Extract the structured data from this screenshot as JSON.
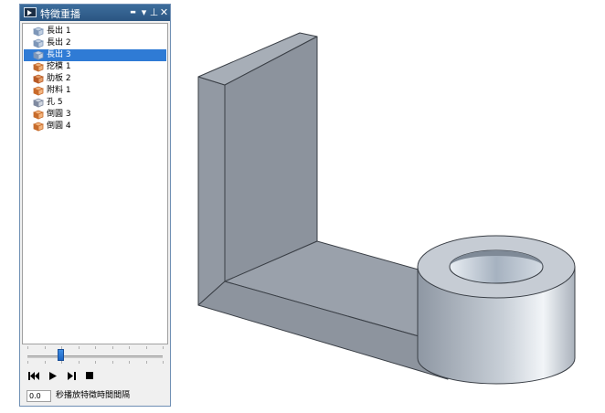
{
  "panel": {
    "title": "特徵重播",
    "icon": "film-player-icon",
    "controls": {
      "minimize": "▬",
      "dropdown": "▾",
      "pin": "⊥",
      "close": "✕"
    }
  },
  "tree": {
    "items": [
      {
        "label": "長出 1",
        "icon": "extrude-icon",
        "selected": false
      },
      {
        "label": "長出 2",
        "icon": "extrude-icon",
        "selected": false
      },
      {
        "label": "長出 3",
        "icon": "extrude-icon",
        "selected": true
      },
      {
        "label": "挖模 1",
        "icon": "cut-icon",
        "selected": false
      },
      {
        "label": "肋板 2",
        "icon": "rib-icon",
        "selected": false
      },
      {
        "label": "附料 1",
        "icon": "add-material-icon",
        "selected": false
      },
      {
        "label": "孔 5",
        "icon": "hole-icon",
        "selected": false
      },
      {
        "label": "倒圓 3",
        "icon": "fillet-icon",
        "selected": false
      },
      {
        "label": "倒圓 4",
        "icon": "fillet-icon",
        "selected": false
      }
    ]
  },
  "playback": {
    "slider_position": 0.25,
    "buttons": [
      "rewind-icon",
      "play-icon",
      "step-forward-icon",
      "stop-icon"
    ]
  },
  "interval": {
    "value": "0.0",
    "label": "秒播放特徵時間間隔"
  },
  "colors": {
    "title_bar": "#2f5d8c",
    "selection": "#2f7bd5",
    "model_face": "#9aa3ae"
  }
}
